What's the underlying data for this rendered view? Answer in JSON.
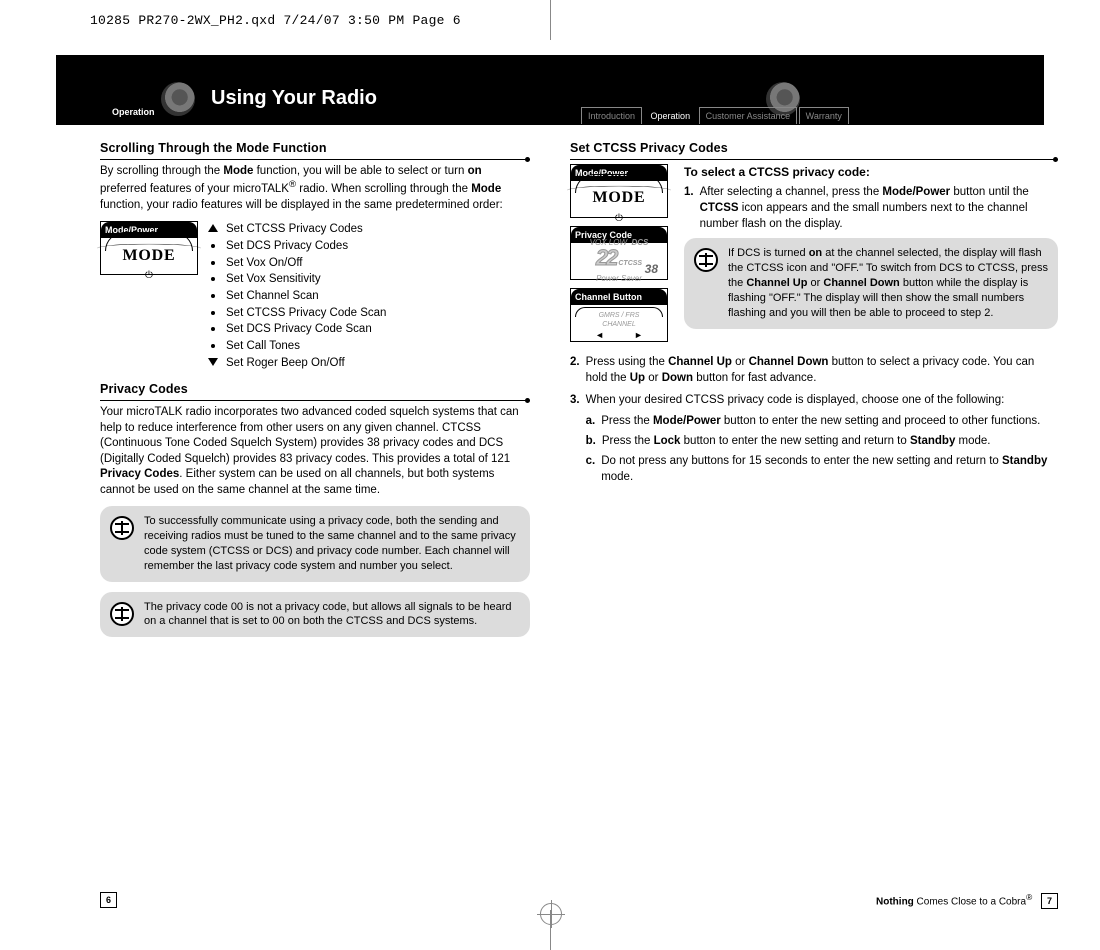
{
  "slug": "10285 PR270-2WX_PH2.qxd  7/24/07  3:50 PM  Page 6",
  "band": {
    "title": "Using Your Radio",
    "ops_label": "Operation",
    "nav": {
      "intro": "Introduction",
      "op": "Operation",
      "cust": "Customer Assistance",
      "warr": "Warranty"
    }
  },
  "left": {
    "h1": "Scrolling Through the Mode Function",
    "p1_a": "By scrolling through the ",
    "p1_b": "Mode",
    "p1_c": " function, you will be able to select or turn ",
    "p1_d": "on",
    "p1_e": " preferred features of your microTALK",
    "p1_f": "®",
    "p1_g": " radio. When scrolling through the ",
    "p1_h": "Mode",
    "p1_i": " function, your radio features will be displayed in the same predetermined order:",
    "btn_mode": "Mode/Power",
    "mode_glyph": "MODE",
    "bullets": [
      "Set CTCSS Privacy Codes",
      "Set DCS Privacy Codes",
      "Set Vox On/Off",
      "Set Vox Sensitivity",
      "Set Channel Scan",
      "Set CTCSS Privacy Code Scan",
      "Set DCS Privacy Code Scan",
      "Set Call Tones",
      "Set Roger Beep On/Off"
    ],
    "h2": "Privacy Codes",
    "p2_a": "Your microTALK radio incorporates two advanced coded squelch systems that can help to reduce interference from other users on any given channel. CTCSS (Continuous Tone Coded Squelch System) provides 38 privacy codes and DCS (Digitally Coded Squelch) provides 83 privacy codes. This provides a total of 121 ",
    "p2_b": "Privacy Codes",
    "p2_c": ". Either system can be used on all channels, but both systems cannot be used on the same channel at the same time.",
    "note1": "To successfully communicate using a privacy code, both the sending and receiving radios must be tuned to the same channel and to the same privacy code system (CTCSS or DCS) and privacy code number. Each channel will remember the last privacy code system and number you select.",
    "note2": "The privacy code 00 is not a privacy code, but allows all signals to be heard on a channel that is set to 00 on both the CTCSS and DCS systems."
  },
  "right": {
    "h1": "Set CTCSS Privacy Codes",
    "btn_mode": "Mode/Power",
    "btn_priv": "Privacy Code",
    "btn_chan": "Channel Button",
    "lcd": {
      "top": "VOX LOW",
      "dcs": "DCS",
      "ctcss": "CTCSS",
      "big": "22",
      "small": "38",
      "bottom": "Power Saver"
    },
    "chan_lcd": {
      "l1": "GMRS / FRS",
      "l2": "CHANNEL"
    },
    "lead": "To select a CTCSS privacy code:",
    "s1_a": "After selecting a channel, press the ",
    "s1_b": "Mode/Power",
    "s1_c": " button until the ",
    "s1_d": "CTCSS",
    "s1_e": " icon appears and the small numbers next to the channel number flash on the display.",
    "note_a": "If DCS is turned ",
    "note_b": "on",
    "note_c": " at the channel selected, the display will flash the CTCSS icon and \"OFF.\" To switch from DCS to CTCSS, press the ",
    "note_d": "Channel Up",
    "note_e": " or ",
    "note_f": "Channel Down",
    "note_g": " button while the display is flashing \"OFF.\" The display will then show the small numbers flashing and you will then be able to proceed to step 2.",
    "s2_a": "Press using the ",
    "s2_b": "Channel Up",
    "s2_c": " or ",
    "s2_d": "Channel Down",
    "s2_e": " button to select a privacy code. You can hold the ",
    "s2_f": "Up",
    "s2_g": " or ",
    "s2_h": "Down",
    "s2_i": " button for fast advance.",
    "s3": "When your desired CTCSS privacy code is displayed, choose one of the following:",
    "s3a_a": "Press the ",
    "s3a_b": "Mode/Power",
    "s3a_c": " button to enter the new setting and proceed to other functions.",
    "s3b_a": "Press the ",
    "s3b_b": "Lock",
    "s3b_c": " button to enter the new setting and return to ",
    "s3b_d": "Standby",
    "s3b_e": " mode.",
    "s3c_a": "Do not press any buttons for 15 seconds to enter the new setting and return to ",
    "s3c_b": "Standby",
    "s3c_c": " mode."
  },
  "footer": {
    "page_left": "6",
    "page_right": "7",
    "tag_a": "Nothing",
    "tag_b": " Comes Close to a Cobra",
    "tag_c": "®"
  }
}
